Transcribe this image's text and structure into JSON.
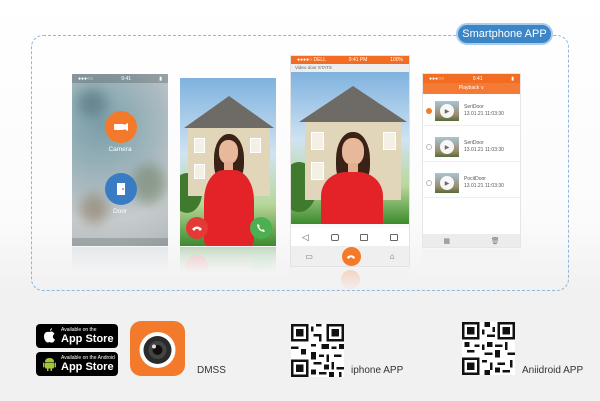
{
  "badge": {
    "label": "Smartphone APP"
  },
  "phone1": {
    "camera_label": "Camera",
    "door_label": "Door"
  },
  "phone3": {
    "status": "9:41 PM",
    "carrier": "●●●●○ DELL",
    "battery": "100%",
    "url": "Video door STATS"
  },
  "phone4": {
    "header": "Playback ∨",
    "records": [
      {
        "title": "SeriDoor",
        "date": "13.01.21 11:03:30"
      },
      {
        "title": "SeriDoor",
        "date": "13.01.21 11:03:30"
      },
      {
        "title": "PocitDoor",
        "date": "13.01.21 11:03:30"
      }
    ]
  },
  "stores": {
    "apple": {
      "small": "Available on the",
      "big": "App Store"
    },
    "android": {
      "small": "Available on the Android",
      "big": "App Store"
    }
  },
  "apps": {
    "dmss_label": "DMSS",
    "iphone_label": "iphone APP",
    "android_label": "Aniidroid APP"
  },
  "colors": {
    "accent": "#f47a2b",
    "badge": "#3d86c6",
    "frame": "#8fb6db",
    "end_call": "#e53935",
    "accept_call": "#4caf50"
  }
}
